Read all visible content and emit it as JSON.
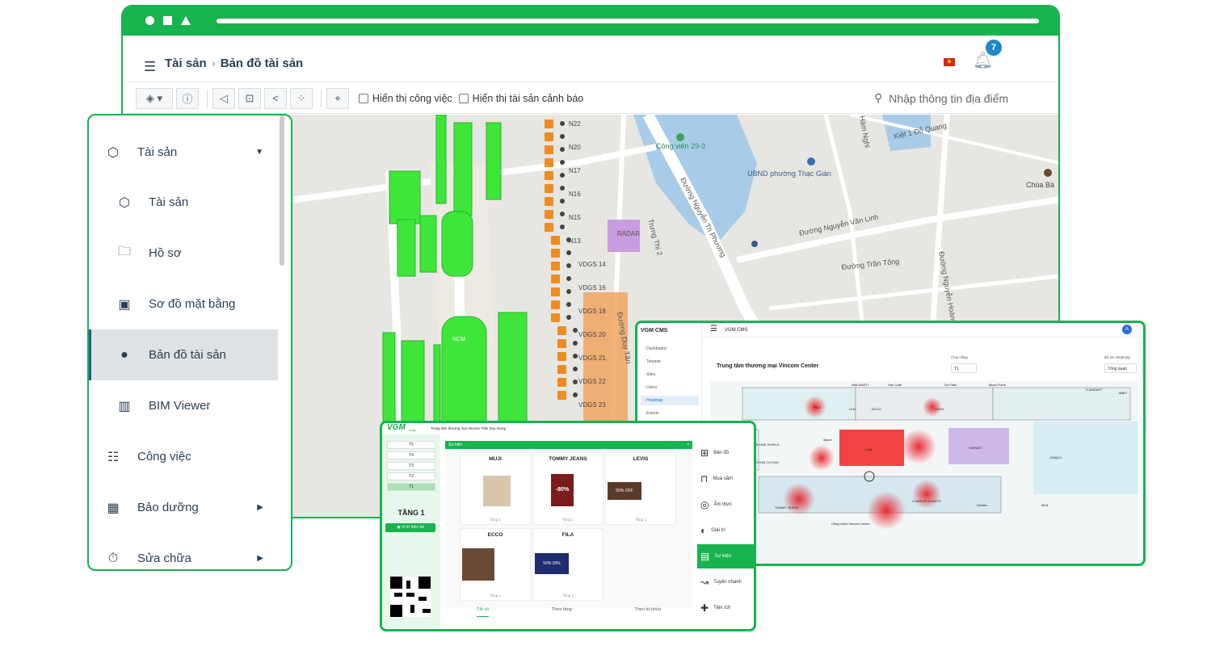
{
  "browser": {
    "breadcrumb": {
      "root": "Tài sản",
      "separator": "›",
      "current": "Bản đồ tài sản"
    },
    "notifications_count": "7",
    "toolbar": {
      "show_work_label": "Hiển thị công việc",
      "show_warning_label": "Hiển thị tài sản cảnh báo",
      "search_placeholder": "Nhập thông tin địa điểm"
    },
    "map": {
      "labels": {
        "park": "Công viên 29-3",
        "ubnd": "UBND phường Thạc Gián",
        "pagoda": "Chùa Bà",
        "street_nguyen_tri_phuong": "Đường Nguyễn Tri Phương",
        "street_nguyen_van_linh": "Đường Nguyễn Văn Linh",
        "street_tran_tong": "Đường Trần Tống",
        "street_nguyen_hoang": "Đường Nguyễn Hoàng",
        "street_ham_nghi": "Hàm Nghi",
        "street_do_quang": "Kiệt 1 Đỗ Quang",
        "street_duy_tan": "Đường Duy Tân",
        "street_truong_thi": "Trưng Thị 2",
        "radar": "RADAR",
        "ncm": "NCM"
      },
      "markers": [
        "N22",
        "N20",
        "N17",
        "N16",
        "N15",
        "N13",
        "VDGS 14",
        "VDGS 16",
        "VDGS 18",
        "VDGS 20",
        "VDGS 21",
        "VDGS 22",
        "VDGS 23"
      ]
    }
  },
  "sidebar": {
    "items": [
      {
        "label": "Tài sản",
        "icon": "cubes-icon"
      },
      {
        "label": "Tài sản",
        "icon": "cubes-icon"
      },
      {
        "label": "Hồ sơ",
        "icon": "folder-icon"
      },
      {
        "label": "Sơ đồ mặt bằng",
        "icon": "floorplan-icon"
      },
      {
        "label": "Bản đồ tài sản",
        "icon": "globe-icon"
      },
      {
        "label": "BIM Viewer",
        "icon": "building-icon"
      },
      {
        "label": "Công việc",
        "icon": "tasks-icon"
      },
      {
        "label": "Bảo dưỡng",
        "icon": "calendar-icon"
      },
      {
        "label": "Sửa chữa",
        "icon": "stopwatch-icon"
      }
    ]
  },
  "cms": {
    "brand": "VGM CMS",
    "header_title": "VGM CMS",
    "avatar": "A",
    "nav": [
      "Dashboard",
      "Tenants",
      "Sites",
      "Users",
      "Heatmap",
      "Events"
    ],
    "page_title": "Trung tâm thương mại Vincom Center",
    "floor_label": "Chọn tầng",
    "floor_value": "T1",
    "filter_label": "Bộ lọc Heatmap",
    "filter_value": "Tổng quan",
    "stores": [
      "WALMART+",
      "Hàn Cafe",
      "De Fatto",
      "Mixed Farm",
      "X-MARKET",
      "JIBBY",
      "FILA",
      "LVN",
      "ECCO",
      "LEVIS",
      "PERFUME WORLD",
      "dyson",
      "Lotte",
      "VINFAST",
      "UNIQLO",
      "THẾ GIỚI KIM CƯƠNG",
      "TOMMY JEANS",
      "CHARLES & KEITH",
      "Dickies",
      "MLB",
      "Cổng chính Vincom Center",
      "Shinhan",
      "HOP"
    ]
  },
  "kiosk": {
    "logo": "VGM",
    "logo_sub": "map",
    "header_title": "Trung tâm thương mại Vincom Trần Duy Hưng",
    "floors": [
      "T5",
      "T4",
      "T3",
      "T2",
      "T1"
    ],
    "current_floor": "TẦNG 1",
    "locate_button": "Vị trí hiện tại",
    "events_title": "Sự kiện",
    "cards": [
      {
        "name": "MUJI",
        "floor": "Tầng 1"
      },
      {
        "name": "TOMMY JEANS",
        "floor": "Tầng 1",
        "promo": "-80%"
      },
      {
        "name": "LEVIS",
        "floor": "Tầng 1",
        "promo": "50% OFF"
      },
      {
        "name": "ECCO",
        "floor": "Tầng 1"
      },
      {
        "name": "FILA",
        "floor": "Tầng 1",
        "promo": "50% 20%"
      }
    ],
    "tabs": [
      "Tất cả",
      "Theo tầng",
      "Theo từ khóa"
    ],
    "menu": [
      "Bản đồ",
      "Mua sắm",
      "Ẩm thực",
      "Giải trí",
      "Sự kiện",
      "Tuyến nhanh",
      "Tiện ích"
    ]
  },
  "colors": {
    "brand_green": "#16b34e",
    "map_green": "#3ee63a",
    "marker_orange": "#ee8c22",
    "heat_red": "#e8232a"
  }
}
